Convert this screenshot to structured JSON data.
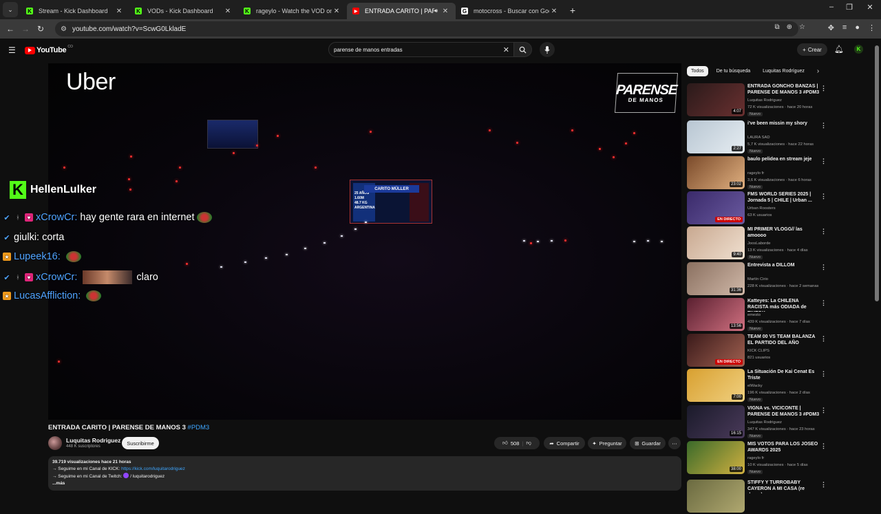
{
  "browser": {
    "tabs": [
      {
        "title": "Stream - Kick Dashboard",
        "fav": "K",
        "color": "#53fc18"
      },
      {
        "title": "VODs - Kick Dashboard",
        "fav": "K",
        "color": "#53fc18"
      },
      {
        "title": "rageylo - Watch the VOD on Kick",
        "fav": "K",
        "color": "#53fc18"
      },
      {
        "title": "ENTRADA CARITO | PARENSE",
        "fav": "▶",
        "color": "#ff0000"
      },
      {
        "title": "motocross - Buscar con Google",
        "fav": "G",
        "color": "#ffffff"
      }
    ],
    "url": "youtube.com/watch?v=ScwG0LkladE"
  },
  "youtube": {
    "logo": "YouTube",
    "country": "CO",
    "search_value": "parense de manos entradas",
    "create_label": "Crear"
  },
  "video_overlay": {
    "sponsor": "Uber",
    "event_logo_line1": "PARENSE",
    "event_logo_line2": "DE MANOS",
    "screen_name": "CARITO MÜLLER",
    "screen_stats": [
      "25 AÑOS",
      "1.60M",
      "48.7 KG",
      "ARGENTINA"
    ],
    "streamer": "HellenLulker",
    "chat": [
      {
        "user": "xCrowCr:",
        "msg": "hay gente rara en internet",
        "user_color": "#4fa3ff"
      },
      {
        "user": "giulki:",
        "msg": "corta",
        "user_color": "#ffffff"
      },
      {
        "user": "Lupeek16:",
        "msg": "",
        "user_color": "#4fa3ff"
      },
      {
        "user": "xCrowCr:",
        "msg": "claro",
        "user_color": "#4fa3ff"
      },
      {
        "user": "LucasAffliction:",
        "msg": "",
        "user_color": "#4fa3ff"
      }
    ]
  },
  "video_info": {
    "title": "ENTRADA CARITO | PARENSE DE MANOS 3",
    "hashtag": "#PDM3",
    "channel": "Luquitas Rodriguez",
    "subscribers": "448 K suscriptores",
    "subscribe_label": "Suscribirme",
    "likes": "508",
    "share_label": "Compartir",
    "ask_label": "Preguntar",
    "save_label": "Guardar",
    "desc_line1": "39.719 visualizaciones  hace 21 horas",
    "desc_kick_prefix": "→ Seguime en mi Canal de KICK: ",
    "desc_kick_link": "https://kick.com/luquitarodriguez",
    "desc_twitch_prefix": "→ Seguime en mi Canal de Twitch: ",
    "desc_twitch_user": "/ luquitarodriguez",
    "desc_more": "...más"
  },
  "sidebar": {
    "chips": [
      "Todos",
      "De tu búsqueda",
      "Luquitas Rodríguez"
    ],
    "recommendations": [
      {
        "title": "ENTRADA GONCHO BANZAS | PARENSE DE MANOS 3 #PDM3",
        "channel": "Luquitas Rodriguez",
        "views": "72 K visualizaciones · hace 20 horas",
        "badge": "Nuevo",
        "duration": "4:07",
        "live": false,
        "c1": "#2a1a1a",
        "c2": "#6a3030"
      },
      {
        "title": "i've been missin my shory",
        "channel": "LAURA SAD",
        "views": "5,7 K visualizaciones · hace 22 horas",
        "badge": "Nuevo",
        "duration": "2:27",
        "live": false,
        "c1": "#b8c6d2",
        "c2": "#e6edf2"
      },
      {
        "title": "baulo pelidea en stream jeje",
        "channel": "rageylo fr",
        "views": "3,6 K visualizaciones · hace 6 horas",
        "badge": "Nuevo",
        "duration": "23:02",
        "live": false,
        "c1": "#7a4a2a",
        "c2": "#e0b080"
      },
      {
        "title": "FMS WORLD SERIES 2025 | Jornada 5 | CHILE | Urban ...",
        "channel": "Urban Roosters",
        "views": "63 K usuarios",
        "badge": "",
        "duration": "EN DIRECTO",
        "live": true,
        "c1": "#3a2a6a",
        "c2": "#6a5aa0"
      },
      {
        "title": "MI PRIMER VLOGG// las amoooo",
        "channel": "JoosLaborde",
        "views": "13 K visualizaciones · hace 4 días",
        "badge": "Nuevo",
        "duration": "9:40",
        "live": false,
        "c1": "#c8a890",
        "c2": "#f0e0d0"
      },
      {
        "title": "Entrevista a DILLOM",
        "channel": "Martín Cirio",
        "views": "228 K visualizaciones · hace 2 semanas",
        "badge": "",
        "duration": "31:36",
        "live": false,
        "c1": "#8a7060",
        "c2": "#d0b8a8"
      },
      {
        "title": "Katteyes: La CHILENA RACISTA más ODIADA de TIKTOK",
        "channel": "emesto",
        "views": "439 K visualizaciones · hace 7 días",
        "badge": "Nuevo",
        "duration": "13:56",
        "live": false,
        "c1": "#5a2030",
        "c2": "#d07080"
      },
      {
        "title": "TEAM 00 VS TEAM BALANZA EL PARTIDO DEL AÑO",
        "channel": "KICK CLIPS",
        "views": "821 usuarios",
        "badge": "",
        "duration": "EN DIRECTO",
        "live": true,
        "c1": "#3a1a1a",
        "c2": "#a06050"
      },
      {
        "title": "La Situación De Kai Cenat Es Triste",
        "channel": "elWacky",
        "views": "196 K visualizaciones · hace 2 días",
        "badge": "Nuevo",
        "duration": "7:00",
        "live": false,
        "c1": "#d8a030",
        "c2": "#f0d080"
      },
      {
        "title": "VIGNA vs. VICICONTE | PARENSE DE MANOS 3 #PDM3",
        "channel": "Luquitas Rodriguez",
        "views": "347 K visualizaciones · hace 23 horas",
        "badge": "Nuevo",
        "duration": "16:15",
        "live": false,
        "c1": "#1a1a2a",
        "c2": "#4a3a5a"
      },
      {
        "title": "MIS VOTOS PARA LOS JOSEO AWARDS 2025",
        "channel": "rageylo fr",
        "views": "10 K visualizaciones · hace 5 días",
        "badge": "Nuevo",
        "duration": "38:00",
        "live": false,
        "c1": "#3a6a2a",
        "c2": "#d0b040"
      },
      {
        "title": "STIFFY Y TURROBABY CAYERON A MI CASA (re duros)",
        "channel": "",
        "views": "",
        "badge": "",
        "duration": "",
        "live": false,
        "c1": "#6a6a40",
        "c2": "#b0a870"
      }
    ]
  }
}
